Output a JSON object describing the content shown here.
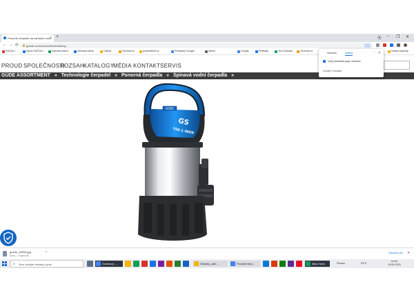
{
  "browser": {
    "tab_title": "Ponorné čerpadlo na zahradní vodu",
    "tab_close": "×",
    "new_tab": "+",
    "window_controls": [
      "⦿",
      "–",
      "❐",
      "✕"
    ],
    "nav": {
      "back": "←",
      "forward": "→",
      "reload": "⟳"
    },
    "url": "guede.com/cz/cz/rbrerbl/cdbs/cg",
    "bookmarks": [
      {
        "label": "RAČALC",
        "color": "#d93025"
      },
      {
        "label": "Admin RAČALC",
        "color": "#1a73e8"
      },
      {
        "label": "Zahrada nalezt",
        "color": "#0f9d58"
      },
      {
        "label": "Zahrada admin",
        "color": "#1a73e8"
      },
      {
        "label": "Objevit",
        "color": "#f4b400"
      },
      {
        "label": "Heureka.cz",
        "color": "#f29900"
      },
      {
        "label": "produktfeed.cz",
        "color": "#f4b400"
      },
      {
        "label": "Překladač Google",
        "color": "#4285f4"
      },
      {
        "label": "Admin",
        "color": "#5f6368"
      },
      {
        "label": "Google",
        "color": "#4285f4"
      },
      {
        "label": "Překlady",
        "color": "#1a73e8"
      },
      {
        "label": "Text Zahrada",
        "color": "#0f9d58"
      },
      {
        "label": "Heureka.cz",
        "color": "#f29900"
      }
    ],
    "bookmarks_right": "Ostatní záložky"
  },
  "translate_popup": {
    "tabs": [
      "němčina",
      "čeština"
    ],
    "active_tab": 1,
    "checkbox_label": "Vždy překládat jazyk němčina",
    "footer": "Google Translate",
    "more": "⋮",
    "close": "✕"
  },
  "site": {
    "nav": [
      "PROUD",
      "SPOLEČNOSTI",
      "ROZSAH",
      "KATALOGY",
      "MÉDIA",
      "KONTAKT",
      "SERVIS"
    ],
    "breadcrumb": [
      "GÜDE ASSORTMENT",
      "»",
      "Technologie čerpadel",
      "»",
      "Ponorná čerpadla",
      "»",
      "Špinavá vodní čerpadla",
      "»"
    ],
    "product": {
      "brand": "GÜDE",
      "model": "GS",
      "subtitle": "750.1 INOX"
    },
    "colors": {
      "accent": "#1e88e5",
      "breadcrumb_bg": "#3b3b3b",
      "pump_body": "#2d2f33",
      "shield": "#1565c0"
    }
  },
  "download": {
    "file_name": "guede_94993.jpg",
    "status": "Done – 0 bytes kB",
    "chevron": "^",
    "show_all": "Zobrazit vše",
    "close": "✕"
  },
  "taskbar": {
    "search_placeholder": "Sem zadejte hledaný výraz",
    "items": [
      {
        "label": "Dominový – ...",
        "dark": true,
        "color": "#4285f4"
      },
      {
        "label": "Obrázky_zahr...",
        "dark": false,
        "color": "#f4b400"
      },
      {
        "label": "Ponorné čerp...",
        "dark": false,
        "color": "#4285f4"
      },
      {
        "label": "Altus Yanis",
        "dark": true,
        "color": "#0f9d58"
      }
    ],
    "weather_label": "Plocha",
    "temperature": "23°C",
    "time": "10:41",
    "date": "13.05.2021"
  }
}
